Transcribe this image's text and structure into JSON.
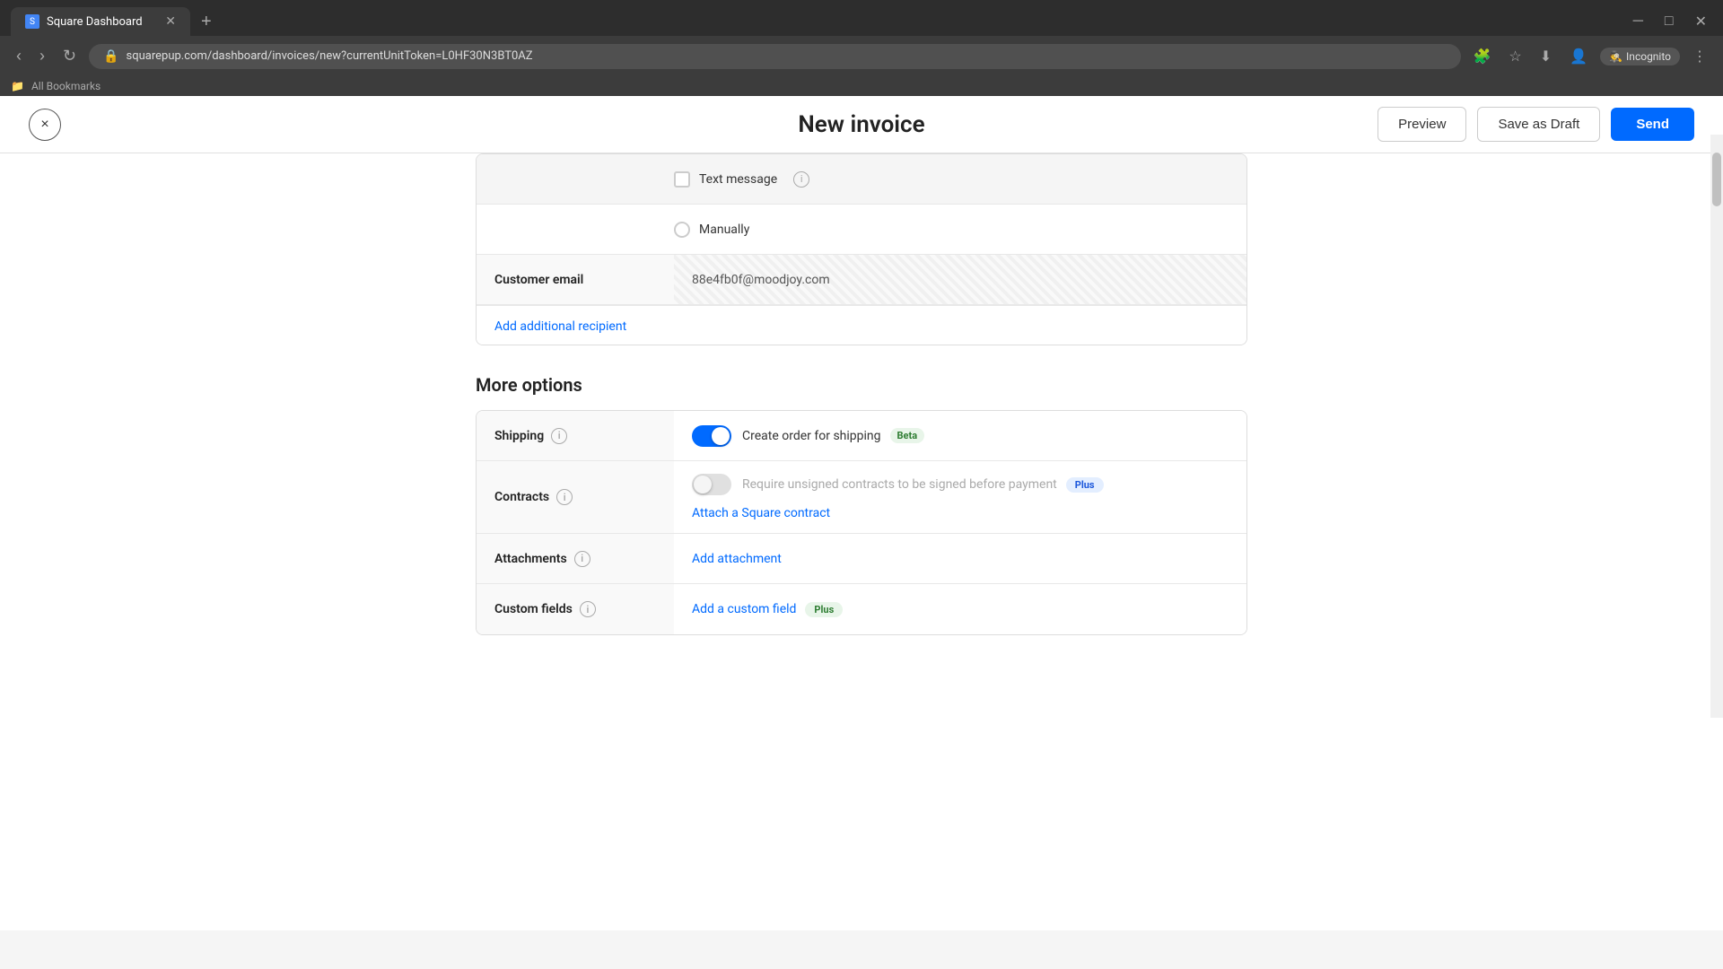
{
  "browser": {
    "tab_title": "Square Dashboard",
    "url": "squarepup.com/dashboard/invoices/new?currentUnitToken=L0HF30N3BT0AZ",
    "new_tab_symbol": "+",
    "incognito_label": "Incognito",
    "bookmarks_label": "All Bookmarks"
  },
  "header": {
    "close_label": "×",
    "page_title": "New invoice",
    "preview_label": "Preview",
    "save_draft_label": "Save as Draft",
    "send_label": "Send"
  },
  "form": {
    "text_message_label": "Text message",
    "manually_label": "Manually",
    "customer_email_label": "Customer email",
    "customer_email_value": "88e4fb0f@moodjoy.com",
    "add_recipient_label": "Add additional recipient"
  },
  "more_options": {
    "section_title": "More options",
    "shipping": {
      "label": "Shipping",
      "toggle_active": true,
      "description": "Create order for shipping",
      "badge": "Beta"
    },
    "contracts": {
      "label": "Contracts",
      "toggle_active": false,
      "toggle_disabled": true,
      "placeholder": "Require unsigned contracts to be signed before payment",
      "badge": "Plus",
      "attach_label": "Attach a Square contract"
    },
    "attachments": {
      "label": "Attachments",
      "add_label": "Add attachment"
    },
    "custom_fields": {
      "label": "Custom fields",
      "add_label": "Add a custom field",
      "badge": "Plus"
    }
  },
  "icons": {
    "info": "i",
    "close": "×"
  }
}
